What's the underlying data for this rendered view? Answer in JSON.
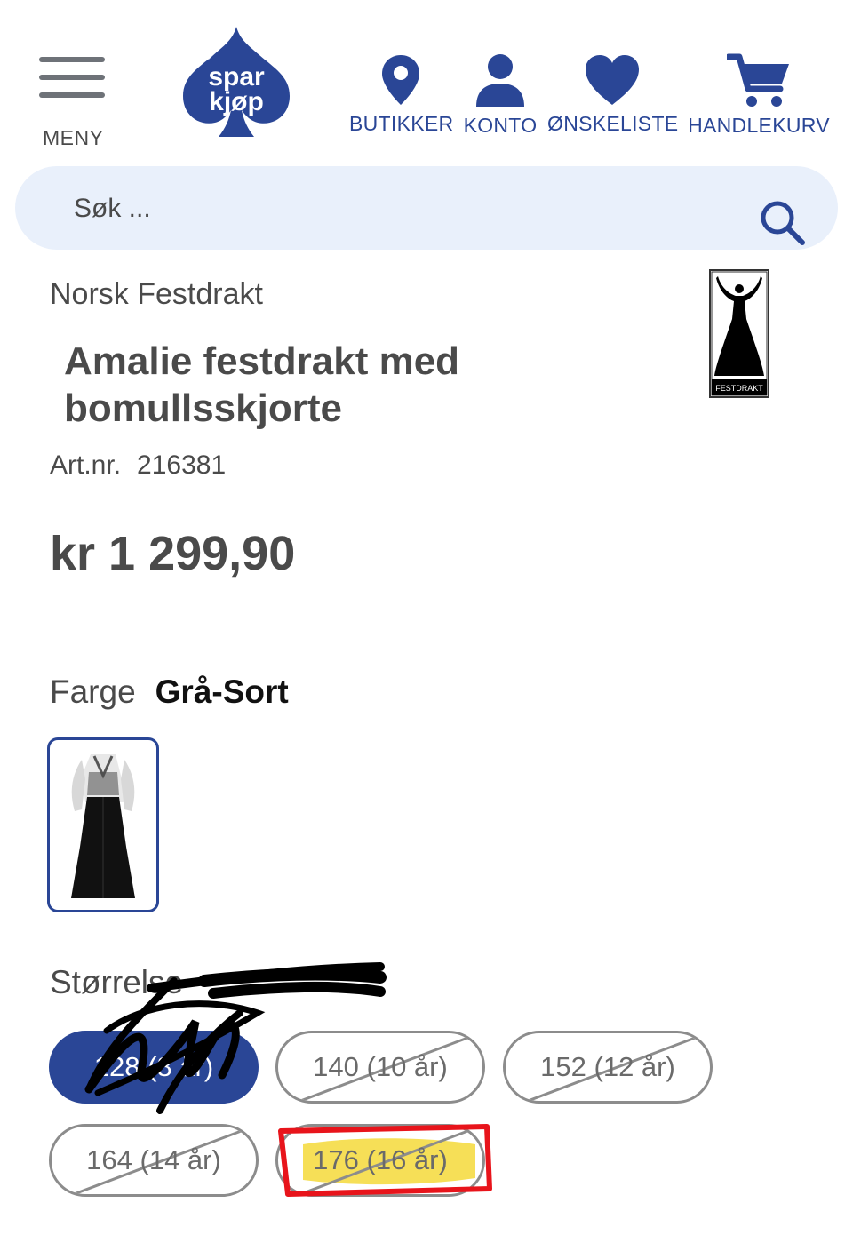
{
  "header": {
    "menu_label": "MENY",
    "logo_text_line1": "spar",
    "logo_text_line2": "kjøp",
    "nav": [
      {
        "label": "BUTIKKER",
        "icon": "location-pin-icon"
      },
      {
        "label": "KONTO",
        "icon": "user-icon"
      },
      {
        "label": "ØNSKELISTE",
        "icon": "heart-icon"
      },
      {
        "label": "HANDLEKURV",
        "icon": "cart-icon"
      }
    ],
    "accent_color": "#2a4696"
  },
  "search": {
    "placeholder": "Søk ...",
    "value": ""
  },
  "product": {
    "brand": "Norsk Festdrakt",
    "brand_logo_text": "FESTDRAKT",
    "title": "Amalie festdrakt med bomullsskjorte",
    "artnr_label": "Art.nr.",
    "artnr_value": "216381",
    "price": "kr 1 299,90",
    "color_label": "Farge",
    "color_value": "Grå-Sort",
    "size_label": "Størrelse",
    "sizes": [
      {
        "label": "128 (8 år)",
        "selected": true,
        "available": true
      },
      {
        "label": "140 (10 år)",
        "selected": false,
        "available": false
      },
      {
        "label": "152 (12 år)",
        "selected": false,
        "available": false
      },
      {
        "label": "164 (14 år)",
        "selected": false,
        "available": false
      },
      {
        "label": "176 (16 år)",
        "selected": false,
        "available": false,
        "highlighted": true
      }
    ]
  },
  "annotations": {
    "highlight_color": "#f5d93a",
    "box_color": "#e8141b",
    "scribble_color": "#000000"
  }
}
